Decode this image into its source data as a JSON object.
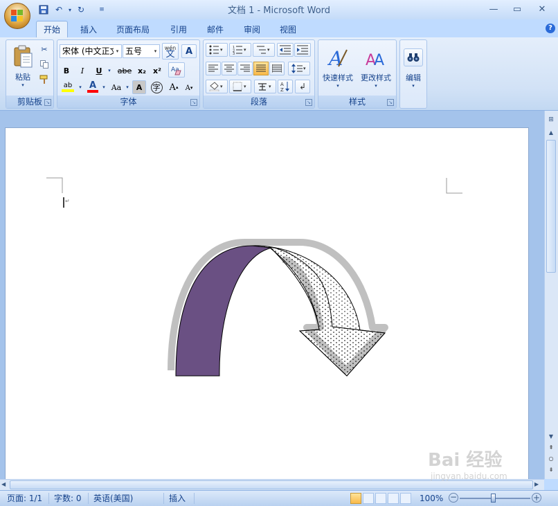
{
  "window": {
    "title": "文档 1 - Microsoft Word",
    "minimize": "—",
    "maximize": "▭",
    "close": "✕"
  },
  "tabs": [
    "开始",
    "插入",
    "页面布局",
    "引用",
    "邮件",
    "审阅",
    "视图"
  ],
  "active_tab": "开始",
  "ribbon": {
    "clipboard": {
      "label": "剪贴板",
      "paste": "粘贴"
    },
    "font": {
      "label": "字体",
      "font_name": "宋体 (中文正文)",
      "font_size": "五号",
      "bold": "B",
      "italic": "I",
      "underline": "U",
      "strike": "abe",
      "subscript": "x₂",
      "superscript": "x²",
      "change_case": "Aa",
      "grow": "A",
      "shrink": "A",
      "char_shade": "A",
      "enclose": "字",
      "phonetic": "wén",
      "phonetic_char": "文"
    },
    "paragraph": {
      "label": "段落"
    },
    "styles": {
      "label": "样式",
      "quick_styles": "快速样式",
      "change_styles": "更改样式"
    },
    "editing": {
      "label": "编辑"
    }
  },
  "colors": {
    "arrow_fill": "#6a5083",
    "shadow": "#c0c0c0",
    "highlight": "#ffff00",
    "font_color": "#ff0000"
  },
  "status": {
    "page": "页面: 1/1",
    "words": "字数: 0",
    "language": "英语(美国)",
    "mode": "插入",
    "zoom": "100%"
  },
  "watermark": {
    "text": "Bai 经验",
    "url": "jingyan.baidu.com"
  }
}
